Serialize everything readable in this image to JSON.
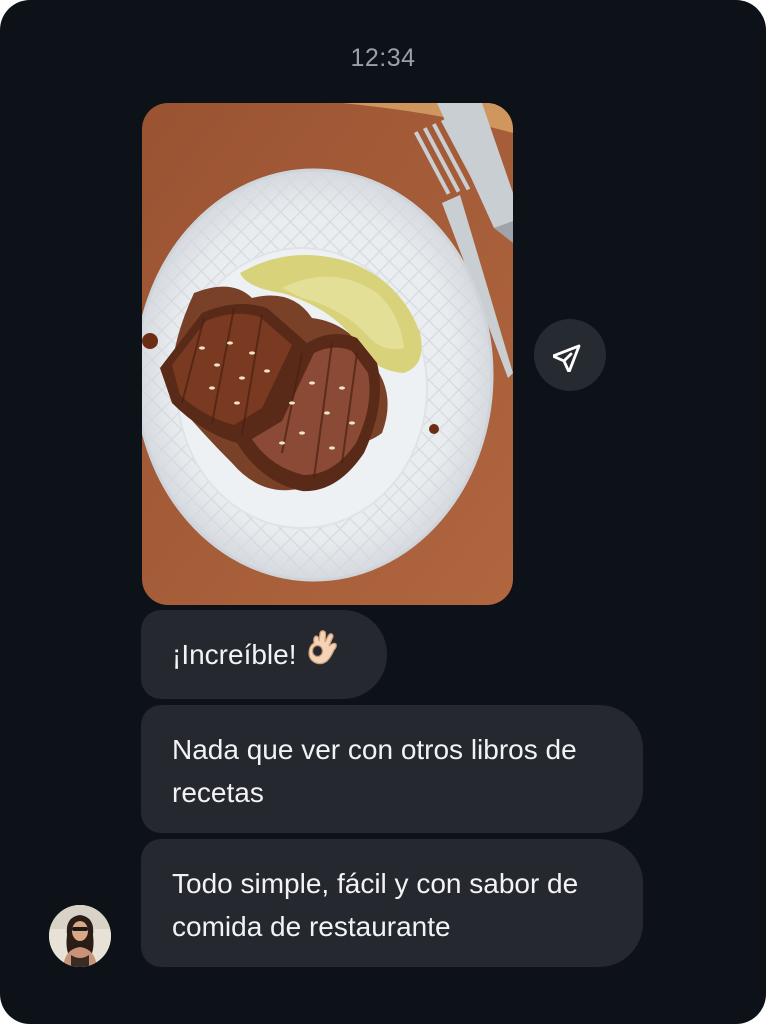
{
  "status": {
    "time": "12:34"
  },
  "messages": {
    "photo_icon": "food-photo",
    "share_icon": "send-arrow-icon",
    "items": [
      {
        "text": "¡Increíble!",
        "emoji": "ok-hand-emoji"
      },
      {
        "text": "Nada que ver con otros libros de recetas"
      },
      {
        "text": "Todo simple, fácil y con sabor de comida de restaurante"
      }
    ]
  },
  "sender": {
    "avatar_icon": "profile-avatar"
  },
  "colors": {
    "background": "#0d1118",
    "bubble": "#25282e",
    "text": "#f2f3f5",
    "timestamp": "#9aa0a8"
  }
}
